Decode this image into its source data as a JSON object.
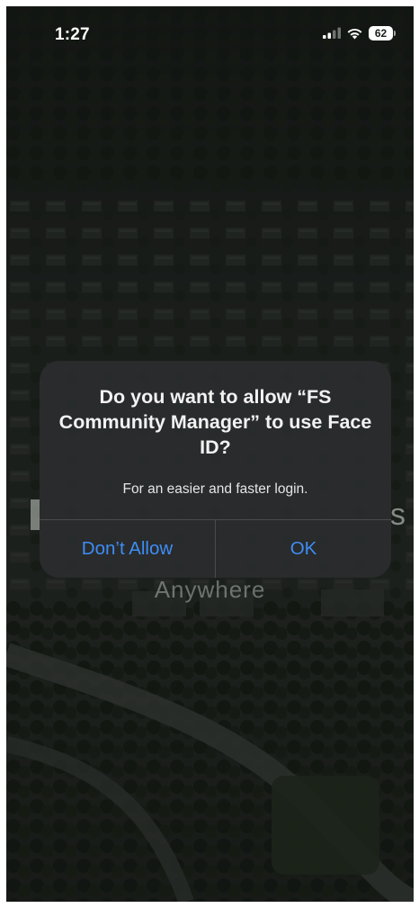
{
  "status_bar": {
    "time": "1:27",
    "battery_level": "62"
  },
  "background": {
    "headline_tail": "s",
    "tagline": "Anywhere"
  },
  "alert": {
    "title": "Do you want to allow “FS Community Manager” to use Face ID?",
    "message": "For an easier and faster login.",
    "deny_label": "Don’t Allow",
    "ok_label": "OK"
  },
  "colors": {
    "accent": "#3e8df5",
    "dialog_bg": "#2a2c2d"
  }
}
